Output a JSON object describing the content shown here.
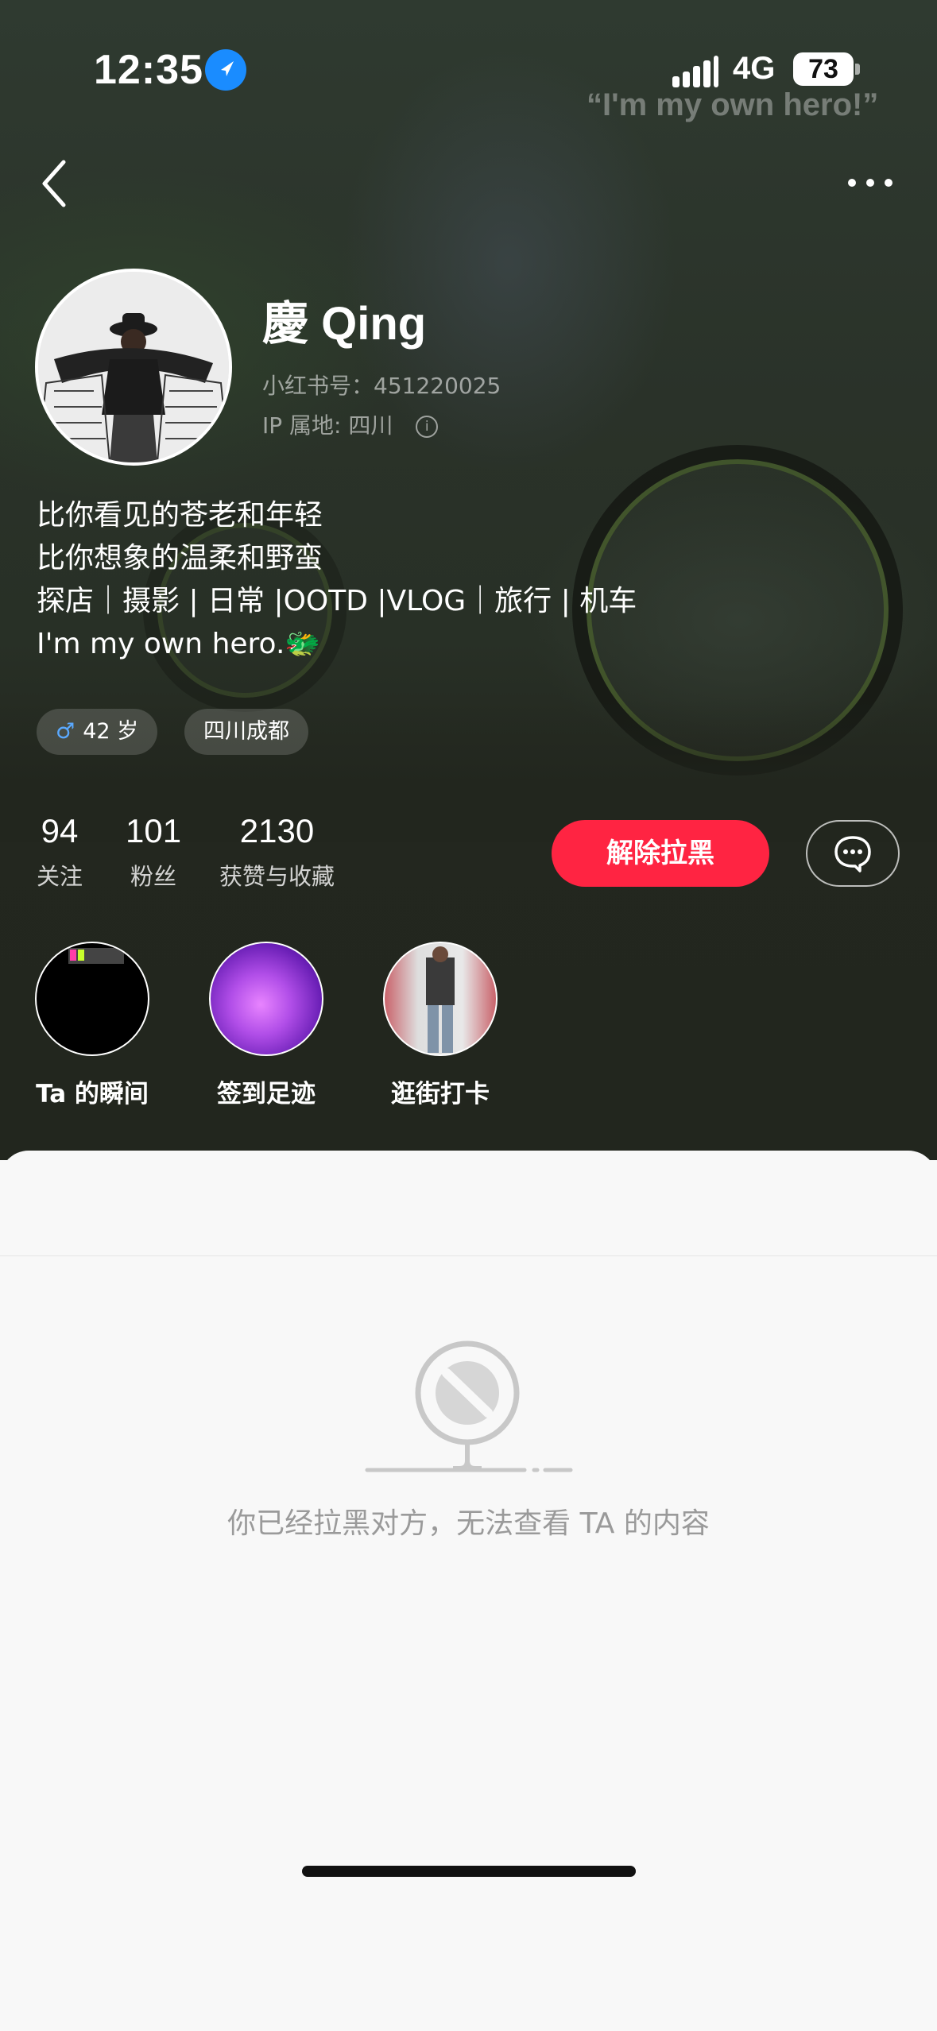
{
  "status_bar": {
    "time": "12:35",
    "network": "4G",
    "battery": "73"
  },
  "banner": {
    "quote": "“I'm my own hero!”"
  },
  "nav": {
    "back_icon": "chevron-left-icon",
    "more_icon": "more-dots-icon"
  },
  "profile": {
    "name": "慶 Qing",
    "id_line": "小红书号：451220025",
    "ip_line": "IP 属地: 四川",
    "bio": [
      "比你看见的苍老和年轻",
      "比你想象的温柔和野蛮",
      "探店｜摄影 | 日常 |OOTD |VLOG｜旅行 | 机车",
      "I'm my own hero.🐲"
    ],
    "tags": [
      {
        "icon": "male-icon",
        "label": "42 岁"
      },
      {
        "label": "四川成都"
      }
    ]
  },
  "stats": [
    {
      "value": "94",
      "label": "关注"
    },
    {
      "value": "101",
      "label": "粉丝"
    },
    {
      "value": "2130",
      "label": "获赞与收藏"
    }
  ],
  "actions": {
    "unblock_label": "解除拉黑",
    "chat_icon": "chat-bubble-icon"
  },
  "highlights": [
    {
      "label": "Ta 的瞬间"
    },
    {
      "label": "签到足迹"
    },
    {
      "label": "逛街打卡"
    }
  ],
  "content": {
    "empty_message": "你已经拉黑对方，无法查看 TA 的内容",
    "empty_icon": "blocked-icon"
  },
  "colors": {
    "accent": "#ff2442",
    "background": "#f8f8f8"
  }
}
